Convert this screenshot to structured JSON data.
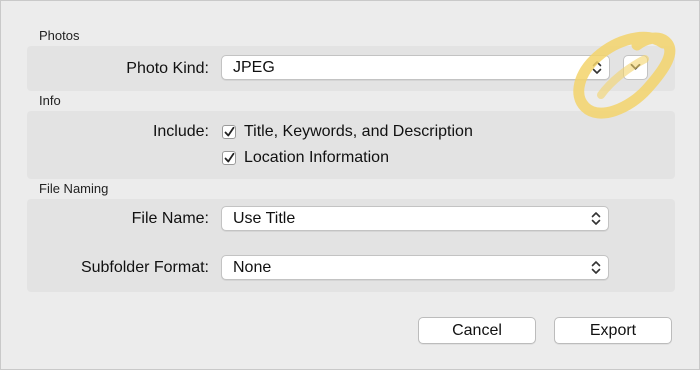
{
  "sections": {
    "photos": {
      "title": "Photos",
      "photo_kind_label": "Photo Kind:",
      "photo_kind_value": "JPEG"
    },
    "info": {
      "title": "Info",
      "include_label": "Include:",
      "options": [
        {
          "label": "Title, Keywords, and Description",
          "checked": true
        },
        {
          "label": "Location Information",
          "checked": true
        }
      ]
    },
    "file_naming": {
      "title": "File Naming",
      "file_name_label": "File Name:",
      "file_name_value": "Use Title",
      "subfolder_label": "Subfolder Format:",
      "subfolder_value": "None"
    }
  },
  "buttons": {
    "cancel": "Cancel",
    "export": "Export"
  },
  "icons": {
    "popup_indicator": "up-down-chevron-icon",
    "disclosure": "chevron-down-icon",
    "checkmark": "checkmark-icon",
    "annotation": "highlight-circle"
  },
  "colors": {
    "annotation": "#f3d36b"
  }
}
